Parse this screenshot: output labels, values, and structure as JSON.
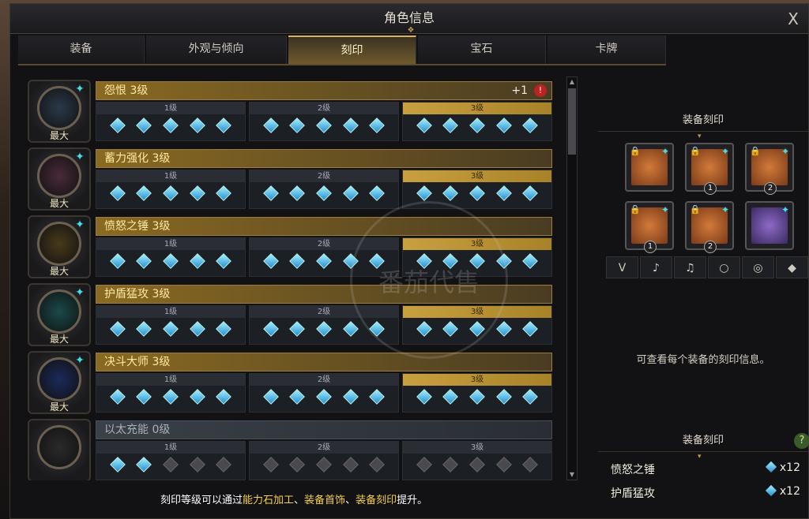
{
  "window": {
    "title": "角色信息",
    "close": "X"
  },
  "tabs": [
    {
      "label": "装备",
      "active": false
    },
    {
      "label": "外观与倾向",
      "active": false
    },
    {
      "label": "刻印",
      "active": true
    },
    {
      "label": "宝石",
      "active": false
    },
    {
      "label": "卡牌",
      "active": false
    }
  ],
  "engravings": [
    {
      "name": "怨恨 3级",
      "badge": "最大",
      "extra": "+1",
      "level": 3,
      "active": true
    },
    {
      "name": "蓄力强化 3级",
      "badge": "最大",
      "level": 3,
      "active": true
    },
    {
      "name": "愤怒之锤 3级",
      "badge": "最大",
      "level": 3,
      "active": true
    },
    {
      "name": "护盾猛攻 3级",
      "badge": "最大",
      "level": 3,
      "active": true
    },
    {
      "name": "决斗大师 3级",
      "badge": "最大",
      "level": 3,
      "active": true
    },
    {
      "name": "以太充能 0级",
      "badge": "",
      "level": 0,
      "active": false
    }
  ],
  "level_labels": [
    "1级",
    "2级",
    "3级"
  ],
  "right_panel": {
    "equip_title": "装备刻印",
    "equip_slots": [
      {
        "icon": "necklace-icon",
        "num": ""
      },
      {
        "icon": "earring-icon",
        "num": "1"
      },
      {
        "icon": "earring-icon",
        "num": "2"
      },
      {
        "icon": "ring-icon",
        "num": "1"
      },
      {
        "icon": "ring-icon",
        "num": "2"
      },
      {
        "icon": "ability-stone-icon",
        "num": ""
      }
    ],
    "filters": [
      "necklace",
      "earring-1",
      "earring-2",
      "ring-1",
      "ring-2",
      "stone"
    ],
    "hint": "可查看每个装备的刻印信息。",
    "summary_title": "装备刻印",
    "summary": [
      {
        "name": "愤怒之锤",
        "value": "x12"
      },
      {
        "name": "护盾猛攻",
        "value": "x12"
      }
    ]
  },
  "footer": {
    "prefix": "刻印等级可以通过",
    "h1": "能力石加工",
    "sep1": "、",
    "h2": "装备首饰",
    "sep2": "、",
    "h3": "装备刻印",
    "suffix": "提升。"
  },
  "watermark": "番茄代售"
}
